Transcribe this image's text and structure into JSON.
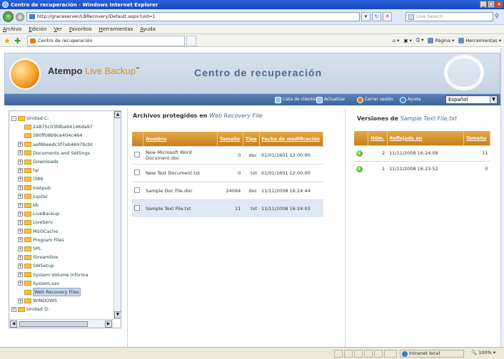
{
  "window": {
    "title": "Centro de recuperación - Windows Internet Explorer"
  },
  "address": {
    "url": "http://graceserver/LBRecovery/Default.aspx?uid=1",
    "search_placeholder": "Live Search"
  },
  "menu": [
    "Archivo",
    "Edición",
    "Ver",
    "Favoritos",
    "Herramientas",
    "Ayuda"
  ],
  "tab": {
    "label": "Centro de recuperación"
  },
  "command_bar": {
    "page": "Página",
    "tools": "Herramientas"
  },
  "header": {
    "brand": "Atempo",
    "brand_accent": "Live Backup",
    "trademark": "™",
    "title": "Centro de recuperación"
  },
  "toolbar": {
    "client_list": "Lista de clientes",
    "refresh": "Actualizar",
    "logout": "Cerrar sesión",
    "help": "Ayuda",
    "language": "Español"
  },
  "tree": {
    "items": [
      {
        "label": "Unidad C:",
        "level": 0,
        "exp": "-"
      },
      {
        "label": "2a875c03fdba64146da97",
        "level": 2,
        "exp": ""
      },
      {
        "label": "580ff08b9ce404c464",
        "level": 2,
        "exp": ""
      },
      {
        "label": "aef8beedc3f7ab4697bcbt",
        "level": 1,
        "exp": "+"
      },
      {
        "label": "Documents and Settings",
        "level": 1,
        "exp": "+"
      },
      {
        "label": "Downloads",
        "level": 1,
        "exp": "+"
      },
      {
        "label": "hp",
        "level": 1,
        "exp": "+"
      },
      {
        "label": "I386",
        "level": 1,
        "exp": "+"
      },
      {
        "label": "Inetpub",
        "level": 1,
        "exp": "+"
      },
      {
        "label": "Jupiter",
        "level": 1,
        "exp": "+"
      },
      {
        "label": "kb",
        "level": 1,
        "exp": "+"
      },
      {
        "label": "LiveBackup",
        "level": 1,
        "exp": "+"
      },
      {
        "label": "LiveServ",
        "level": 1,
        "exp": "+"
      },
      {
        "label": "MSOCache",
        "level": 1,
        "exp": "+"
      },
      {
        "label": "Program Files",
        "level": 1,
        "exp": "+"
      },
      {
        "label": "SPL",
        "level": 1,
        "exp": "+"
      },
      {
        "label": "Streamline",
        "level": 1,
        "exp": "+"
      },
      {
        "label": "SWSetup",
        "level": 1,
        "exp": "+"
      },
      {
        "label": "System Volume Informa",
        "level": 1,
        "exp": "+"
      },
      {
        "label": "System.sav",
        "level": 1,
        "exp": "+"
      },
      {
        "label": "Web Recovery Files",
        "level": 2,
        "exp": "",
        "selected": true
      },
      {
        "label": "WINDOWS",
        "level": 1,
        "exp": "+"
      },
      {
        "label": "Unidad D:",
        "level": 0,
        "exp": "+"
      }
    ]
  },
  "files": {
    "title_prefix": "Archivos protegidos en",
    "title_folder": "Web Recovery File",
    "headers": {
      "name": "Nombre",
      "size": "Tamaño",
      "type": "Tipo",
      "date": "Fecha de modificación"
    },
    "rows": [
      {
        "name": "New Microsoft Word Document.doc",
        "size": "0",
        "type": "doc",
        "date": "01/01/1601 12:00:00"
      },
      {
        "name": "New Text Document.txt",
        "size": "0",
        "type": "txt",
        "date": "01/01/1601 12:00:00"
      },
      {
        "name": "Sample Doc File.doc",
        "size": "24064",
        "type": "doc",
        "date": "11/11/2008 16:24:44"
      },
      {
        "name": "Sample Text File.txt",
        "size": "11",
        "type": "txt",
        "date": "11/11/2008 16:24:03",
        "selected": true
      }
    ]
  },
  "versions": {
    "title_prefix": "Versiones de",
    "title_file": "Sample Text File.txt",
    "headers": {
      "num": "Núm.",
      "reflected": "Reflejado en",
      "size": "Tamaño"
    },
    "rows": [
      {
        "num": "2",
        "reflected": "11/11/2008 16:24:08",
        "size": "11"
      },
      {
        "num": "1",
        "reflected": "11/11/2008 16:23:52",
        "size": "0"
      }
    ]
  },
  "status": {
    "zone": "Intranet local",
    "zoom": "100%"
  },
  "colors": {
    "toolbar": "#3e669c",
    "table_header": "#d89530",
    "accent": "#e8861a"
  }
}
